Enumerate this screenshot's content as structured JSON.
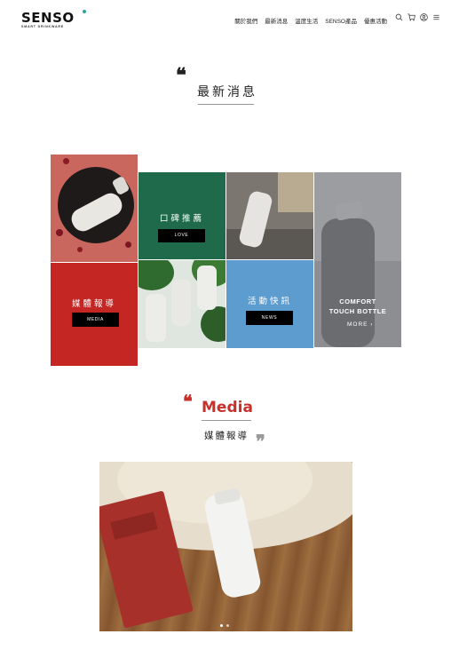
{
  "brand": {
    "name": "SENSO",
    "tagline": "SMART DRINKWARE"
  },
  "nav": {
    "items": [
      {
        "label": "關於我們"
      },
      {
        "label": "最新消息"
      },
      {
        "label": "溫度生活"
      },
      {
        "label": "SENSO產品"
      },
      {
        "label": "優惠活動"
      }
    ],
    "icons": [
      "search-icon",
      "cart-icon",
      "user-icon",
      "menu-icon"
    ]
  },
  "news": {
    "quote_mark": "❝",
    "title": "最新消息"
  },
  "tiles": {
    "love": {
      "title": "口碑推薦",
      "button": "LOVE",
      "color": "#1f6a4b"
    },
    "media": {
      "title": "媒體報導",
      "button": "MEDIA",
      "color": "#c42624"
    },
    "news": {
      "title": "活動快訊",
      "button": "NEWS",
      "color": "#5d9ccf"
    },
    "comfort": {
      "line1": "COMFORT",
      "line2": "TOUCH BOTTLE",
      "more": "MORE ›"
    }
  },
  "media_section": {
    "open_quote": "❝",
    "title": "Media",
    "subtitle": "媒體報導",
    "close_quote": "❞"
  },
  "carousel": {
    "active_index": 0,
    "count": 2
  },
  "colors": {
    "accent_red": "#c8312b",
    "brand_teal": "#2aa89a"
  }
}
